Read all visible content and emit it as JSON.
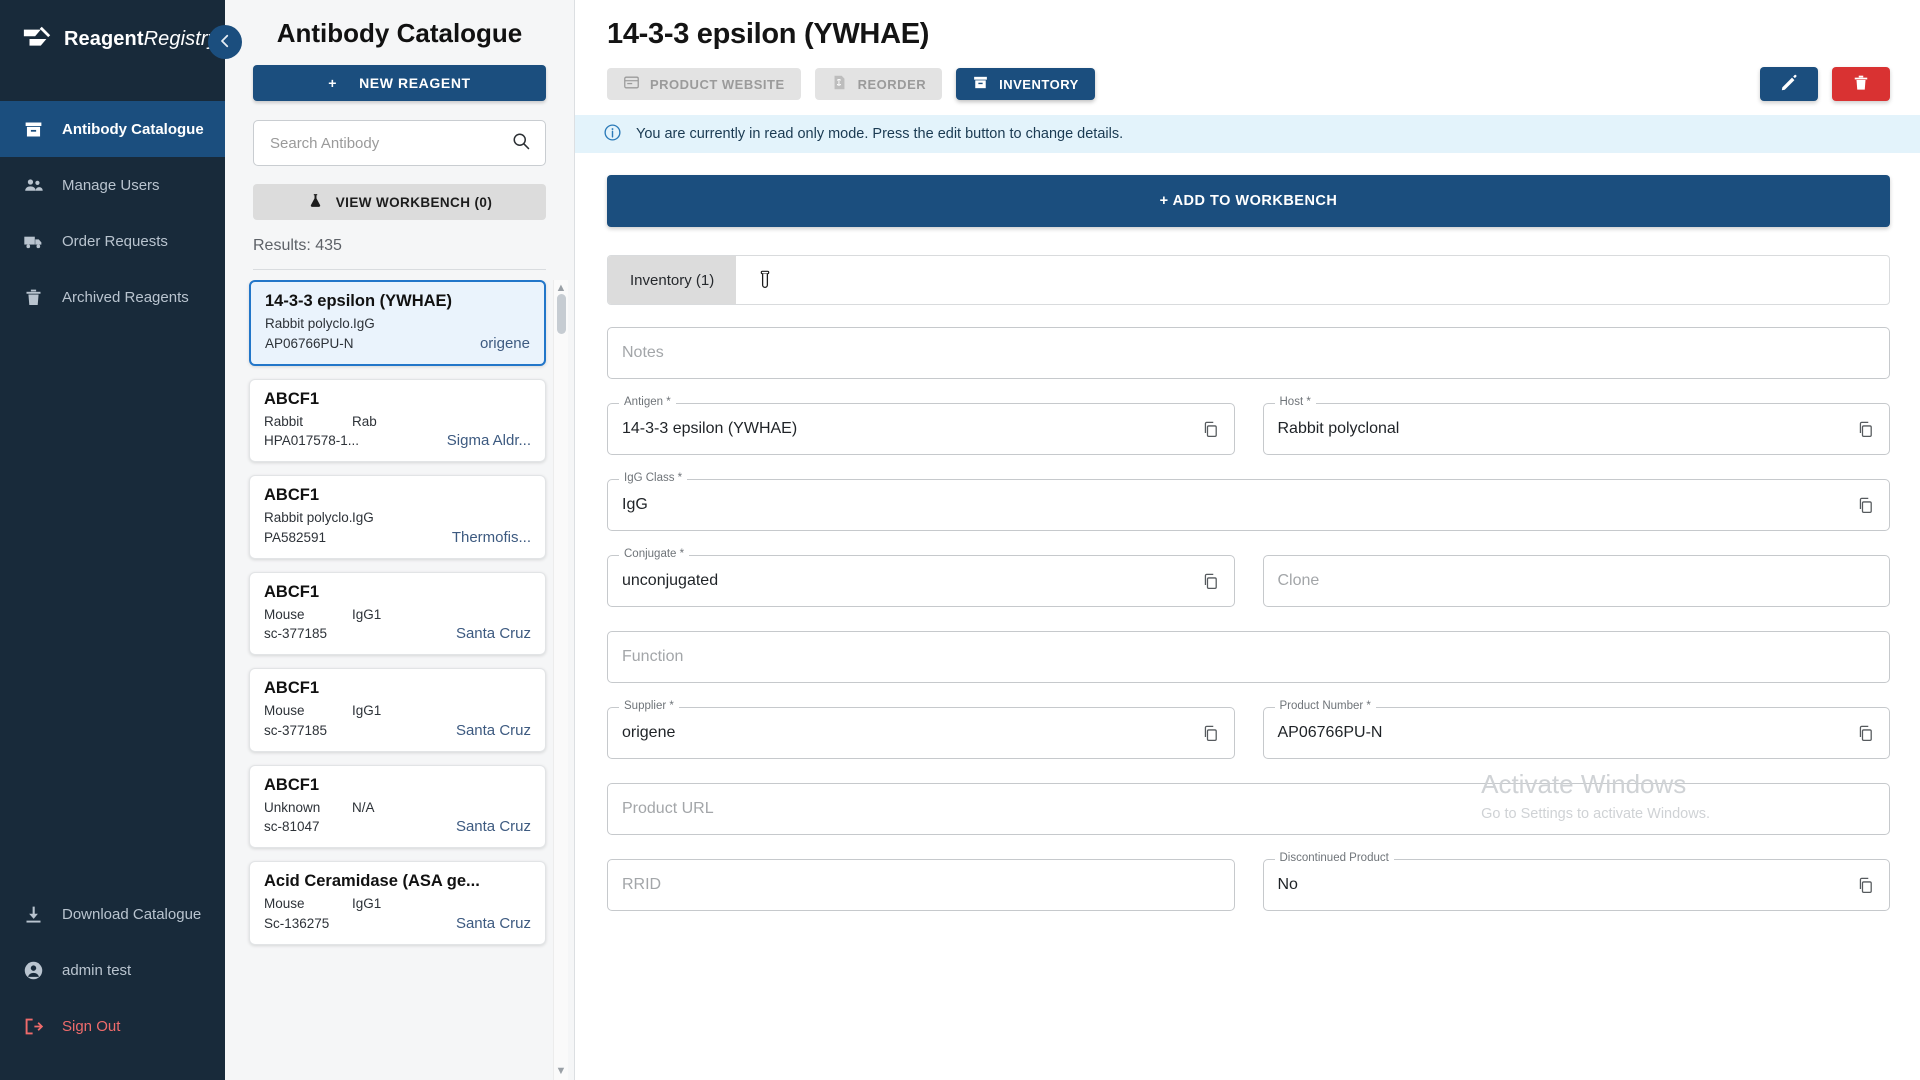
{
  "brand": {
    "name_bold": "Reagent",
    "name_italic": "Registry"
  },
  "sidebar": {
    "items": [
      {
        "label": "Antibody Catalogue",
        "icon": "archive-icon",
        "active": true
      },
      {
        "label": "Manage Users",
        "icon": "people-icon",
        "active": false
      },
      {
        "label": "Order Requests",
        "icon": "truck-icon",
        "active": false
      },
      {
        "label": "Archived Reagents",
        "icon": "trash-icon",
        "active": false
      }
    ],
    "bottom_items": [
      {
        "label": "Download Catalogue",
        "icon": "download-icon"
      },
      {
        "label": "admin test",
        "icon": "account-icon"
      },
      {
        "label": "Sign Out",
        "icon": "logout-icon"
      }
    ],
    "collapse_icon": "chevron-left-icon"
  },
  "catalogue": {
    "title": "Antibody Catalogue",
    "new_reagent_label": "NEW REAGENT",
    "new_reagent_plus": "+",
    "search_placeholder": "Search Antibody",
    "search_value": "",
    "search_icon": "search-icon",
    "workbench_label": "VIEW WORKBENCH (0)",
    "workbench_icon": "flask-icon",
    "results_label": "Results: 435",
    "items": [
      {
        "name": "14-3-3 epsilon (YWHAE)",
        "host": "Rabbit polyclo...",
        "igg": "IgG",
        "product_number": "AP06766PU-N",
        "supplier": "origene",
        "selected": true
      },
      {
        "name": "ABCF1",
        "host": "Rabbit",
        "igg": "Rab",
        "product_number": "HPA017578-1...",
        "supplier": "Sigma Aldr...",
        "selected": false
      },
      {
        "name": "ABCF1",
        "host": "Rabbit polyclo...",
        "igg": "IgG",
        "product_number": "PA582591",
        "supplier": "Thermofis...",
        "selected": false
      },
      {
        "name": "ABCF1",
        "host": "Mouse",
        "igg": "IgG1",
        "product_number": "sc-377185",
        "supplier": "Santa Cruz",
        "selected": false
      },
      {
        "name": "ABCF1",
        "host": "Mouse",
        "igg": "IgG1",
        "product_number": "sc-377185",
        "supplier": "Santa Cruz",
        "selected": false
      },
      {
        "name": "ABCF1",
        "host": "Unknown",
        "igg": "N/A",
        "product_number": "sc-81047",
        "supplier": "Santa Cruz",
        "selected": false
      },
      {
        "name": "Acid Ceramidase (ASA ge...",
        "host": "Mouse",
        "igg": "IgG1",
        "product_number": "Sc-136275",
        "supplier": "Santa Cruz",
        "selected": false
      }
    ]
  },
  "detail": {
    "title": "14-3-3 epsilon (YWHAE)",
    "chips": [
      {
        "label": "PRODUCT WEBSITE",
        "icon": "website-icon",
        "style": "disabled"
      },
      {
        "label": "REORDER",
        "icon": "invoice-icon",
        "style": "disabled"
      },
      {
        "label": "INVENTORY",
        "icon": "box-icon",
        "style": "primary"
      }
    ],
    "edit_icon": "pencil-icon",
    "delete_icon": "trash-icon",
    "info_icon": "info-icon",
    "info_message": "You are currently in read only mode. Press the edit button to change details.",
    "add_to_workbench_label": "+ ADD TO WORKBENCH",
    "tab_label": "Inventory (1)",
    "tab_icon": "test-tube-icon",
    "copy_icon": "copy-icon",
    "fields": {
      "notes": {
        "label": "",
        "placeholder": "Notes",
        "value": "",
        "copy": false
      },
      "antigen": {
        "label": "Antigen *",
        "value": "14-3-3 epsilon (YWHAE)",
        "copy": true
      },
      "host": {
        "label": "Host *",
        "value": "Rabbit polyclonal",
        "copy": true
      },
      "igg_class": {
        "label": "IgG Class *",
        "value": "IgG",
        "copy": true
      },
      "conjugate": {
        "label": "Conjugate *",
        "value": "unconjugated",
        "copy": true
      },
      "clone": {
        "label": "",
        "placeholder": "Clone",
        "value": "",
        "copy": false
      },
      "function": {
        "label": "",
        "placeholder": "Function",
        "value": "",
        "copy": false
      },
      "supplier": {
        "label": "Supplier *",
        "value": "origene",
        "copy": true
      },
      "product_number": {
        "label": "Product Number *",
        "value": "AP06766PU-N",
        "copy": true
      },
      "product_url": {
        "label": "",
        "placeholder": "Product URL",
        "value": "",
        "copy": false
      },
      "rrid": {
        "label": "",
        "placeholder": "RRID",
        "value": "",
        "copy": false
      },
      "discontinued": {
        "label": "Discontinued Product",
        "value": "No",
        "copy": true
      }
    }
  },
  "watermark": {
    "line1": "Activate Windows",
    "line2": "Go to Settings to activate Windows."
  },
  "colors": {
    "brand_dark": "#182a3a",
    "accent": "#1b4e7e",
    "danger": "#d93232",
    "info_bg": "#e3f3fb",
    "selected_card": "#eaf3fc"
  }
}
